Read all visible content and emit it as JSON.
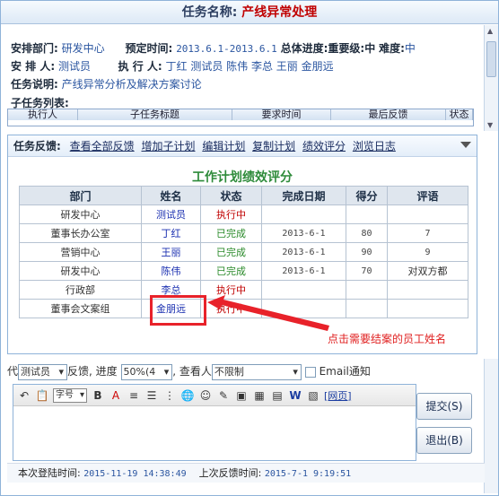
{
  "task": {
    "title_label": "任务名称:",
    "title_value": "产线异常处理"
  },
  "info": {
    "dept_label": "安排部门:",
    "dept_value": "研发中心",
    "time_label": "预定时间:",
    "time_value": "2013.6.1-2013.6.1",
    "progress_label": "总体进度:",
    "progress_value": "重要级:中",
    "difficulty_label": "难度:",
    "difficulty_value": "中",
    "arranger_label": "安 排 人:",
    "arranger_value": "测试员",
    "executors_label": "执 行 人:",
    "executors_value": "丁红 测试员 陈伟 李总 王丽 金朋远",
    "desc_label": "任务说明:",
    "desc_value": "产线异常分析及解决方案讨论"
  },
  "subtasks": {
    "label": "子任务列表:",
    "columns": [
      "执行人",
      "子任务标题",
      "要求时间",
      "最后反馈",
      "状态"
    ]
  },
  "feedback": {
    "label": "任务反馈:",
    "links": [
      "查看全部反馈",
      "增加子计划",
      "编辑计划",
      "复制计划",
      "绩效评分",
      "浏览日志"
    ]
  },
  "evaluation": {
    "title": "工作计划绩效评分",
    "columns": [
      "部门",
      "姓名",
      "状态",
      "完成日期",
      "得分",
      "评语"
    ],
    "rows": [
      {
        "dept": "研发中心",
        "name": "测试员",
        "status": "执行中",
        "date": "",
        "score": "",
        "comment": ""
      },
      {
        "dept": "董事长办公室",
        "name": "丁红",
        "status": "已完成",
        "date": "2013-6-1",
        "score": "80",
        "comment": "7"
      },
      {
        "dept": "营销中心",
        "name": "王丽",
        "status": "已完成",
        "date": "2013-6-1",
        "score": "90",
        "comment": "9"
      },
      {
        "dept": "研发中心",
        "name": "陈伟",
        "status": "已完成",
        "date": "2013-6-1",
        "score": "70",
        "comment": "对双方都"
      },
      {
        "dept": "行政部",
        "name": "李总",
        "status": "执行中",
        "date": "",
        "score": "",
        "comment": ""
      },
      {
        "dept": "董事会文案组",
        "name": "金朋远",
        "status": "执行中",
        "date": "",
        "score": "",
        "comment": ""
      }
    ],
    "annotation": "点击需要结案的员工姓名"
  },
  "reply": {
    "proxy_prefix": "代",
    "proxy_value": "测试员",
    "feedback_text": "反馈,",
    "progress_label": "进度",
    "progress_value": "50%(4",
    "viewer_label": "查看人",
    "viewer_value": "不限制",
    "email_label": "Email通知",
    "font_value": "字号",
    "web_label": "[网页]"
  },
  "buttons": {
    "submit": "提交(S)",
    "exit": "退出(B)"
  },
  "status_bar": {
    "login_label": "本次登陆时间:",
    "login_value": "2015-11-19 14:38:49",
    "last_label": "上次反馈时间:",
    "last_value": "2015-7-1 9:19:51"
  }
}
